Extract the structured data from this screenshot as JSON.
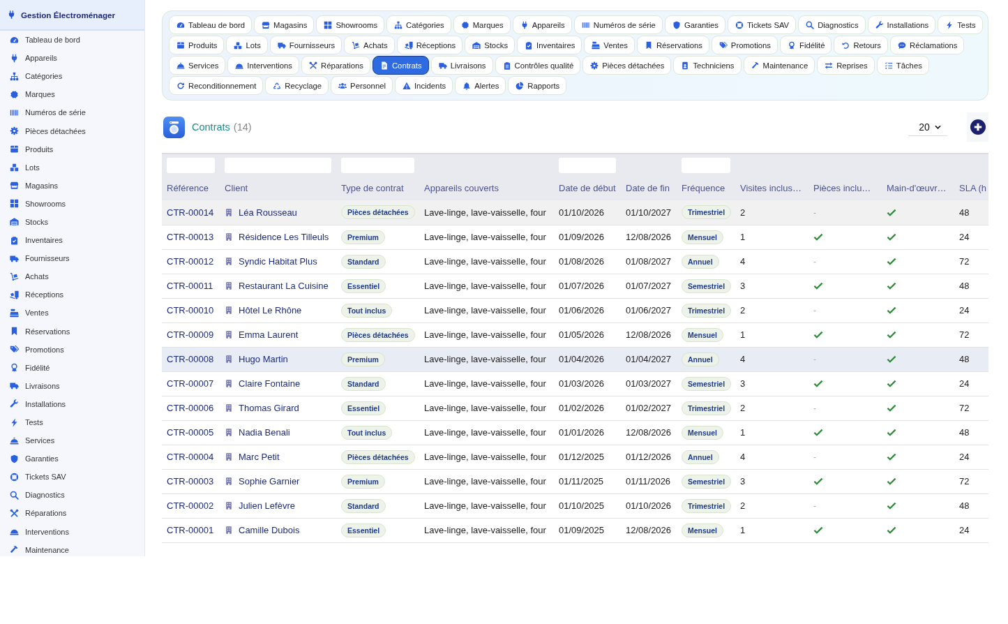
{
  "sidebar": {
    "title": "Gestion Électroménager",
    "items": [
      {
        "label": "Tableau de bord",
        "selected": false
      },
      {
        "label": "Appareils",
        "selected": false
      },
      {
        "label": "Catégories",
        "selected": false
      },
      {
        "label": "Marques",
        "selected": false
      },
      {
        "label": "Numéros de série",
        "selected": false
      },
      {
        "label": "Pièces détachées",
        "selected": false
      },
      {
        "label": "Produits",
        "selected": false
      },
      {
        "label": "Lots",
        "selected": false
      },
      {
        "label": "Magasins",
        "selected": false
      },
      {
        "label": "Showrooms",
        "selected": false
      },
      {
        "label": "Stocks",
        "selected": false
      },
      {
        "label": "Inventaires",
        "selected": false
      },
      {
        "label": "Fournisseurs",
        "selected": false
      },
      {
        "label": "Achats",
        "selected": false
      },
      {
        "label": "Réceptions",
        "selected": false
      },
      {
        "label": "Ventes",
        "selected": false
      },
      {
        "label": "Réservations",
        "selected": false
      },
      {
        "label": "Promotions",
        "selected": false
      },
      {
        "label": "Fidélité",
        "selected": false
      },
      {
        "label": "Livraisons",
        "selected": false
      },
      {
        "label": "Installations",
        "selected": false
      },
      {
        "label": "Tests",
        "selected": false
      },
      {
        "label": "Services",
        "selected": false
      },
      {
        "label": "Garanties",
        "selected": false
      },
      {
        "label": "Tickets SAV",
        "selected": false
      },
      {
        "label": "Diagnostics",
        "selected": false
      },
      {
        "label": "Réparations",
        "selected": false
      },
      {
        "label": "Interventions",
        "selected": false
      },
      {
        "label": "Maintenance",
        "selected": false
      }
    ]
  },
  "nav_tabs": {
    "rows": [
      {
        "tabs": [
          {
            "label": "Tableau de bord",
            "selected": false
          },
          {
            "label": "Magasins",
            "selected": false
          },
          {
            "label": "Showrooms",
            "selected": false
          },
          {
            "label": "Catégories",
            "selected": false
          },
          {
            "label": "Marques",
            "selected": false
          },
          {
            "label": "Appareils",
            "selected": false
          },
          {
            "label": "Numéros de série",
            "selected": false
          },
          {
            "label": "Garanties",
            "selected": false
          },
          {
            "label": "Tickets SAV",
            "selected": false
          },
          {
            "label": "Diagnostics",
            "selected": false
          },
          {
            "label": "Installations",
            "selected": false
          },
          {
            "label": "Tests",
            "selected": false
          }
        ]
      },
      {
        "tabs": [
          {
            "label": "Produits",
            "selected": false
          },
          {
            "label": "Lots",
            "selected": false
          },
          {
            "label": "Fournisseurs",
            "selected": false
          },
          {
            "label": "Achats",
            "selected": false
          },
          {
            "label": "Réceptions",
            "selected": false
          },
          {
            "label": "Stocks",
            "selected": false
          },
          {
            "label": "Inventaires",
            "selected": false
          },
          {
            "label": "Ventes",
            "selected": false
          },
          {
            "label": "Réservations",
            "selected": false
          },
          {
            "label": "Promotions",
            "selected": false
          },
          {
            "label": "Fidélité",
            "selected": false
          },
          {
            "label": "Retours",
            "selected": false
          },
          {
            "label": "Réclamations",
            "selected": false
          }
        ]
      },
      {
        "tabs": [
          {
            "label": "Services",
            "selected": false
          },
          {
            "label": "Interventions",
            "selected": false
          },
          {
            "label": "Réparations",
            "selected": false
          },
          {
            "label": "Contrats",
            "selected": true
          },
          {
            "label": "Livraisons",
            "selected": false
          },
          {
            "label": "Contrôles qualité",
            "selected": false
          },
          {
            "label": "Pièces détachées",
            "selected": false
          },
          {
            "label": "Techniciens",
            "selected": false
          },
          {
            "label": "Maintenance",
            "selected": false
          },
          {
            "label": "Reprises",
            "selected": false
          },
          {
            "label": "Tâches",
            "selected": false
          }
        ]
      },
      {
        "tabs": [
          {
            "label": "Reconditionnement",
            "selected": false
          },
          {
            "label": "Recyclage",
            "selected": false
          },
          {
            "label": "Personnel",
            "selected": false
          },
          {
            "label": "Incidents",
            "selected": false
          },
          {
            "label": "Alertes",
            "selected": false
          },
          {
            "label": "Rapports",
            "selected": false
          }
        ]
      }
    ]
  },
  "content": {
    "title": "Contrats",
    "count": "(14)",
    "page_size": "20"
  },
  "table": {
    "empty_mark": "-",
    "columns": [
      {
        "label": "Référence",
        "kind": "link",
        "filter": true
      },
      {
        "label": "Client",
        "kind": "client",
        "filter": true
      },
      {
        "label": "Type de contrat",
        "kind": "tag",
        "filter": true
      },
      {
        "label": "Appareils couverts",
        "kind": "text",
        "filter": false
      },
      {
        "label": "Date de début",
        "kind": "text",
        "filter": true
      },
      {
        "label": "Date de fin",
        "kind": "text",
        "filter": false
      },
      {
        "label": "Fréquence",
        "kind": "tag",
        "filter": true
      },
      {
        "label": "Visites inclus…",
        "kind": "text",
        "filter": false
      },
      {
        "label": "Pièces inclu…",
        "kind": "flag",
        "filter": false
      },
      {
        "label": "Main-d'œuvr…",
        "kind": "flag",
        "filter": false
      },
      {
        "label": "SLA (h",
        "kind": "text",
        "filter": false
      }
    ],
    "rows": [
      {
        "reference": "CTR-00014",
        "client": "Léa Rousseau",
        "contract_type": "Pièces détachées",
        "appliances": "Lave-linge, lave-vaisselle, four",
        "start_date": "01/10/2026",
        "end_date": "01/10/2027",
        "frequency": "Trimestriel",
        "visits": "2",
        "parts_included": false,
        "labor_included": true,
        "sla": "48",
        "selected": false,
        "focused": true
      },
      {
        "reference": "CTR-00013",
        "client": "Résidence Les Tilleuls",
        "contract_type": "Premium",
        "appliances": "Lave-linge, lave-vaisselle, four",
        "start_date": "01/09/2026",
        "end_date": "12/08/2026",
        "frequency": "Mensuel",
        "visits": "1",
        "parts_included": true,
        "labor_included": true,
        "sla": "24",
        "selected": false,
        "focused": false
      },
      {
        "reference": "CTR-00012",
        "client": "Syndic Habitat Plus",
        "contract_type": "Standard",
        "appliances": "Lave-linge, lave-vaisselle, four",
        "start_date": "01/08/2026",
        "end_date": "01/08/2027",
        "frequency": "Annuel",
        "visits": "4",
        "parts_included": false,
        "labor_included": true,
        "sla": "72",
        "selected": false,
        "focused": false
      },
      {
        "reference": "CTR-00011",
        "client": "Restaurant La Cuisine",
        "contract_type": "Essentiel",
        "appliances": "Lave-linge, lave-vaisselle, four",
        "start_date": "01/07/2026",
        "end_date": "01/07/2027",
        "frequency": "Semestriel",
        "visits": "3",
        "parts_included": true,
        "labor_included": true,
        "sla": "48",
        "selected": false,
        "focused": false
      },
      {
        "reference": "CTR-00010",
        "client": "Hôtel Le Rhône",
        "contract_type": "Tout inclus",
        "appliances": "Lave-linge, lave-vaisselle, four",
        "start_date": "01/06/2026",
        "end_date": "01/06/2027",
        "frequency": "Trimestriel",
        "visits": "2",
        "parts_included": false,
        "labor_included": true,
        "sla": "24",
        "selected": false,
        "focused": false
      },
      {
        "reference": "CTR-00009",
        "client": "Emma Laurent",
        "contract_type": "Pièces détachées",
        "appliances": "Lave-linge, lave-vaisselle, four",
        "start_date": "01/05/2026",
        "end_date": "12/08/2026",
        "frequency": "Mensuel",
        "visits": "1",
        "parts_included": true,
        "labor_included": true,
        "sla": "72",
        "selected": false,
        "focused": false
      },
      {
        "reference": "CTR-00008",
        "client": "Hugo Martin",
        "contract_type": "Premium",
        "appliances": "Lave-linge, lave-vaisselle, four",
        "start_date": "01/04/2026",
        "end_date": "01/04/2027",
        "frequency": "Annuel",
        "visits": "4",
        "parts_included": false,
        "labor_included": true,
        "sla": "48",
        "selected": true,
        "focused": false
      },
      {
        "reference": "CTR-00007",
        "client": "Claire Fontaine",
        "contract_type": "Standard",
        "appliances": "Lave-linge, lave-vaisselle, four",
        "start_date": "01/03/2026",
        "end_date": "01/03/2027",
        "frequency": "Semestriel",
        "visits": "3",
        "parts_included": true,
        "labor_included": true,
        "sla": "24",
        "selected": false,
        "focused": false
      },
      {
        "reference": "CTR-00006",
        "client": "Thomas Girard",
        "contract_type": "Essentiel",
        "appliances": "Lave-linge, lave-vaisselle, four",
        "start_date": "01/02/2026",
        "end_date": "01/02/2027",
        "frequency": "Trimestriel",
        "visits": "2",
        "parts_included": false,
        "labor_included": true,
        "sla": "72",
        "selected": false,
        "focused": false
      },
      {
        "reference": "CTR-00005",
        "client": "Nadia Benali",
        "contract_type": "Tout inclus",
        "appliances": "Lave-linge, lave-vaisselle, four",
        "start_date": "01/01/2026",
        "end_date": "12/08/2026",
        "frequency": "Mensuel",
        "visits": "1",
        "parts_included": true,
        "labor_included": true,
        "sla": "48",
        "selected": false,
        "focused": false
      },
      {
        "reference": "CTR-00004",
        "client": "Marc Petit",
        "contract_type": "Pièces détachées",
        "appliances": "Lave-linge, lave-vaisselle, four",
        "start_date": "01/12/2025",
        "end_date": "01/12/2026",
        "frequency": "Annuel",
        "visits": "4",
        "parts_included": false,
        "labor_included": true,
        "sla": "24",
        "selected": false,
        "focused": false
      },
      {
        "reference": "CTR-00003",
        "client": "Sophie Garnier",
        "contract_type": "Premium",
        "appliances": "Lave-linge, lave-vaisselle, four",
        "start_date": "01/11/2025",
        "end_date": "01/11/2026",
        "frequency": "Semestriel",
        "visits": "3",
        "parts_included": true,
        "labor_included": true,
        "sla": "72",
        "selected": false,
        "focused": false
      },
      {
        "reference": "CTR-00002",
        "client": "Julien Lefèvre",
        "contract_type": "Standard",
        "appliances": "Lave-linge, lave-vaisselle, four",
        "start_date": "01/10/2025",
        "end_date": "01/10/2026",
        "frequency": "Trimestriel",
        "visits": "2",
        "parts_included": false,
        "labor_included": true,
        "sla": "48",
        "selected": false,
        "focused": false
      },
      {
        "reference": "CTR-00001",
        "client": "Camille Dubois",
        "contract_type": "Essentiel",
        "appliances": "Lave-linge, lave-vaisselle, four",
        "start_date": "01/09/2025",
        "end_date": "12/08/2026",
        "frequency": "Mensuel",
        "visits": "1",
        "parts_included": true,
        "labor_included": true,
        "sla": "24",
        "selected": false,
        "focused": false
      }
    ]
  }
}
